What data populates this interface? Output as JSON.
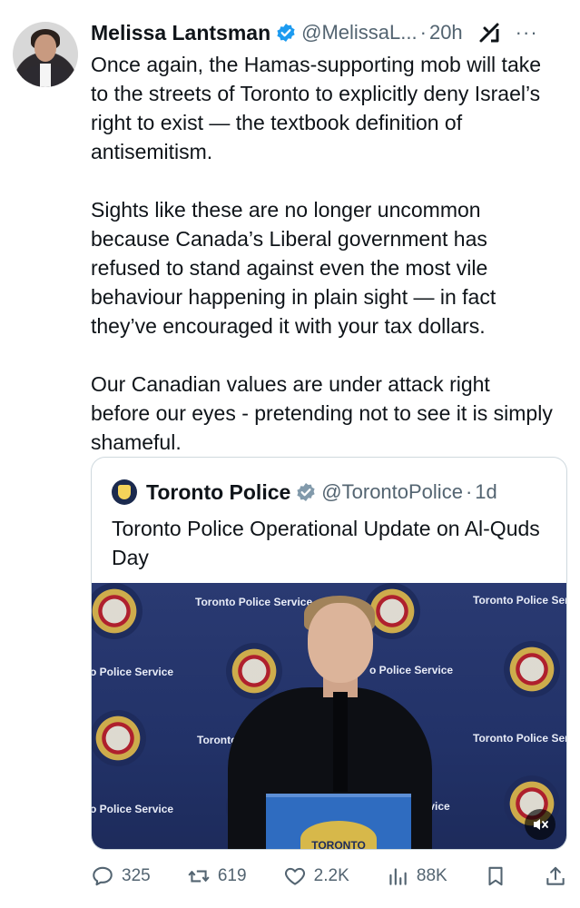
{
  "tweet": {
    "author": {
      "name": "Melissa Lantsman",
      "handle": "@MelissaL...",
      "time": "20h"
    },
    "body": [
      "Once again, the Hamas-supporting mob will take to the streets of Toronto to explicitly deny Israel’s right to exist — the textbook definition of antisemitism.",
      "Sights like these are no longer uncommon because Canada’s Liberal government has refused to stand against even the most vile behaviour happening in plain sight — in fact they’ve encouraged it with your tax dollars.",
      "Our Canadian values are under attack right before our eyes - pretending not to see it is simply shameful."
    ],
    "quote": {
      "name": "Toronto Police",
      "handle": "@TorontoPolice",
      "time": "1d",
      "text": "Toronto Police Operational Update on Al-Quds Day",
      "media_backdrop": {
        "label_full": "Toronto Police Service",
        "label_left_a": "o Police Service",
        "label_right_a": "Toronto Police Ser",
        "label_mid_a": "o Police Service",
        "label_mid_b": "Toronto P",
        "label_right_b": "Toronto Police Ser",
        "label_left_b": "o Police Service",
        "label_mid_c": "ervice",
        "podium_text": "TORONTO"
      }
    },
    "metrics": {
      "replies": "325",
      "reposts": "619",
      "likes": "2.2K",
      "views": "88K"
    }
  },
  "colors": {
    "text": "#0f1419",
    "secondary": "#536471",
    "verified": "#1d9bf0",
    "border": "#cfd9de"
  },
  "icons": [
    "verified-badge-icon",
    "grok-icon",
    "more-icon",
    "mute-icon",
    "reply-icon",
    "repost-icon",
    "like-icon",
    "views-icon",
    "bookmark-icon",
    "share-icon"
  ]
}
